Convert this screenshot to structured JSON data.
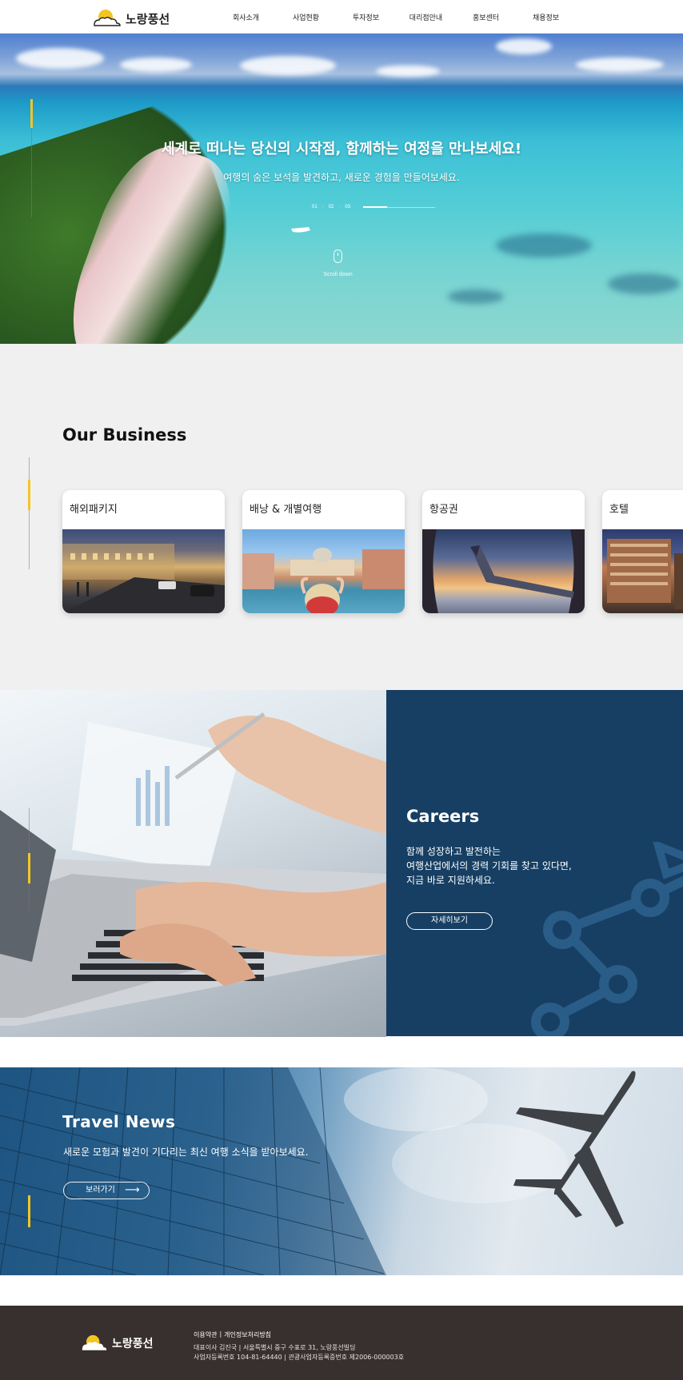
{
  "brand": {
    "name": "노랑풍선",
    "accent": "#f3c524"
  },
  "header": {
    "nav": [
      "회사소개",
      "사업현황",
      "투자정보",
      "대리점안내",
      "홍보센터",
      "채용정보"
    ]
  },
  "hero": {
    "title": "세계로 떠나는 당신의 시작점, 함께하는 여정을 만나보세요!",
    "subtitle": "여행의 숨은 보석을 발견하고, 새로운 경험을 만들어보세요.",
    "slides": [
      "01",
      "02",
      "03"
    ],
    "active_slide_fraction": 0.33,
    "scroll_label": "Scroll down"
  },
  "business": {
    "title": "Our Business",
    "cards": [
      {
        "label": "해외패키지"
      },
      {
        "label": "배낭 & 개별여행"
      },
      {
        "label": "항공권"
      },
      {
        "label": "호텔"
      }
    ]
  },
  "careers": {
    "title": "Careers",
    "desc": [
      "함께 성장하고 발전하는",
      "여행산업에서의 경력 기회를 찾고 있다면,",
      "지금 바로 지원하세요."
    ],
    "button": "자세히보기",
    "panel_color": "#163f63"
  },
  "news": {
    "title": "Travel News",
    "desc": "새로운 모험과 발견이 기다리는 최신 여행 소식을 받아보세요.",
    "button": "보러가기"
  },
  "footer": {
    "links": [
      "이용약관",
      "개인정보처리방침"
    ],
    "separator": "|",
    "info": [
      "대표이사 김진국 | 서울특별시 중구 수표로 31, 노랑풍선빌딩",
      "사업자등록번호 104-81-64440 | 관광사업자등록증번호 제2006-000003호"
    ],
    "bg_color": "#38302e"
  }
}
